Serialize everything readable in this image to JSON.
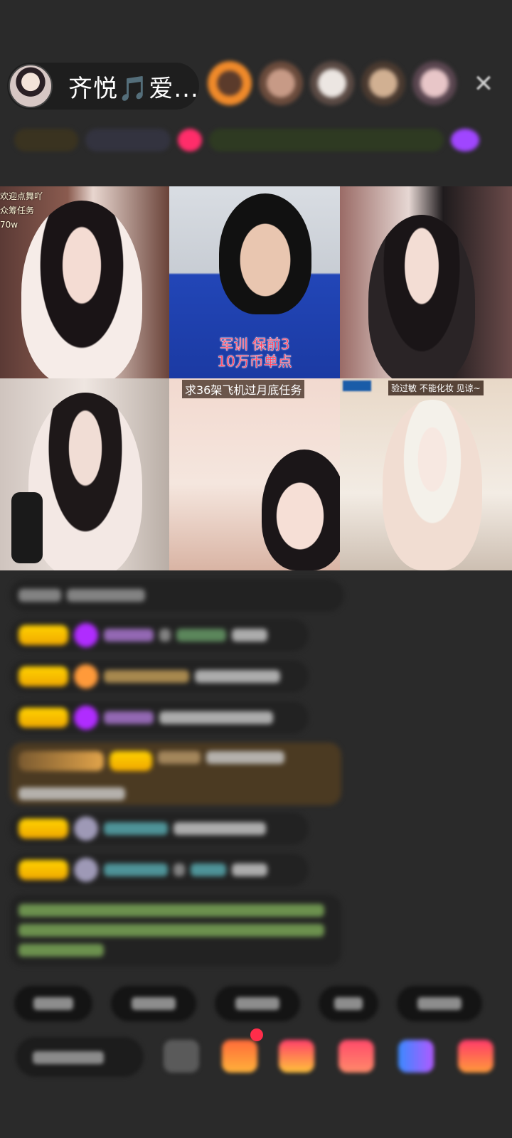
{
  "header": {
    "host_name": "齐悦🎵爱...",
    "close_icon": "close-icon"
  },
  "grid": {
    "cell1_overlay": [
      "欢迎点舞吖",
      "众筹任务",
      "70w"
    ],
    "cell2_overlay": [
      "军训 保前3",
      "10万币单点"
    ],
    "cell5_banner": "求36架飞机过月底任务",
    "cell6_banner": "验过敏 不能化妆 见谅~"
  },
  "colors": {
    "background": "#2a2a2a",
    "badge_gold": "#f5b800",
    "accent_red": "#ff2d4a"
  }
}
